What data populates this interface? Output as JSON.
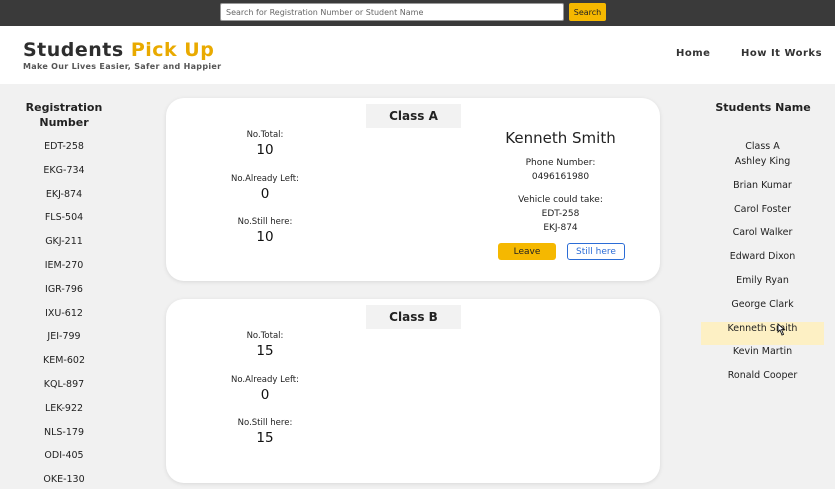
{
  "search": {
    "placeholder": "Search for Registration Number or Student Name",
    "button_label": "Search"
  },
  "brand": {
    "title_part1": "Students",
    "title_part2": "Pick Up",
    "tagline": "Make Our Lives Easier, Safer and Happier"
  },
  "nav": {
    "home": "Home",
    "how_it_works": "How It Works"
  },
  "colors": {
    "accent": "#f5b800",
    "topbar": "#3a3a3a",
    "link_blue": "#2b6cd6"
  },
  "registration": {
    "heading": "Registration Number",
    "items": [
      "EDT-258",
      "EKG-734",
      "EKJ-874",
      "FLS-504",
      "GKJ-211",
      "IEM-270",
      "IGR-796",
      "IXU-612",
      "JEI-799",
      "KEM-602",
      "KQL-897",
      "LEK-922",
      "NLS-179",
      "ODI-405",
      "OKE-130"
    ]
  },
  "students": {
    "heading": "Students Name",
    "items": [
      "Class A",
      "Ashley King",
      "Brian Kumar",
      "Carol Foster",
      "Carol Walker",
      "Edward Dixon",
      "Emily Ryan",
      "George Clark",
      "Kenneth Smith",
      "Kevin Martin",
      "Ronald Cooper"
    ],
    "selected": "Kenneth Smith"
  },
  "class_a": {
    "title": "Class A",
    "total_label": "No.Total:",
    "total_value": "10",
    "left_label": "No.Already Left:",
    "left_value": "0",
    "still_label": "No.Still here:",
    "still_value": "10",
    "student": {
      "name": "Kenneth Smith",
      "phone_label": "Phone Number:",
      "phone": "0496161980",
      "vehicle_label": "Vehicle could take:",
      "vehicles": [
        "EDT-258",
        "EKJ-874"
      ],
      "leave_label": "Leave",
      "still_label": "Still here"
    }
  },
  "class_b": {
    "title": "Class B",
    "total_label": "No.Total:",
    "total_value": "15",
    "left_label": "No.Already Left:",
    "left_value": "0",
    "still_label": "No.Still here:",
    "still_value": "15"
  }
}
